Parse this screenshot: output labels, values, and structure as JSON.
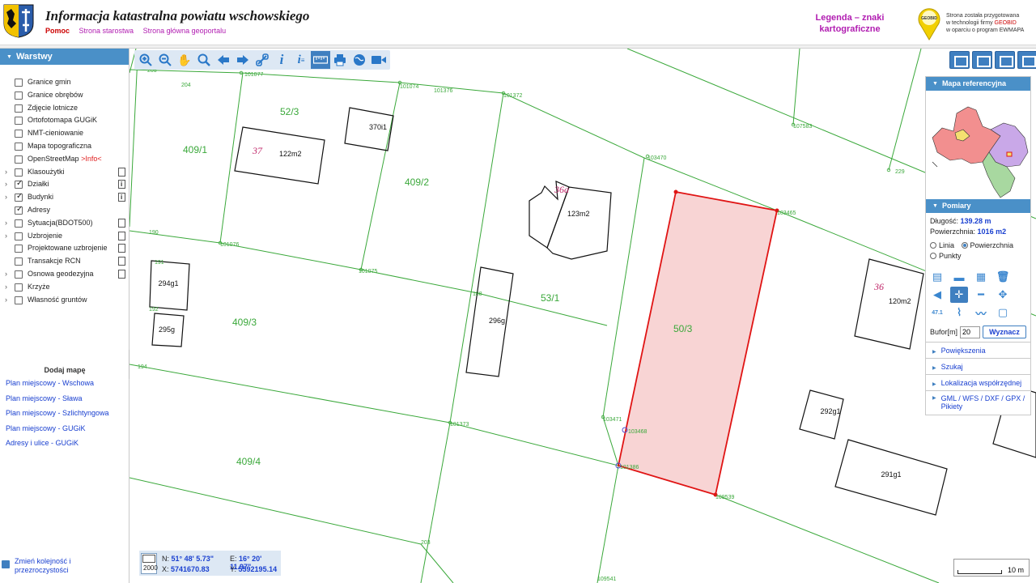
{
  "header": {
    "title": "Informacja katastralna powiatu wschowskiego",
    "links": [
      "Pomoc",
      "Strona starostwa",
      "Strona główna geoportalu"
    ],
    "legend_line1": "Legenda – znaki",
    "legend_line2": "kartograficzne",
    "geobid_line1": "Strona została przygotowana",
    "geobid_line2": "w technologii firmy",
    "geobid_brand": "GEOBID",
    "geobid_line3": "w oparciu o program EWMAPA",
    "geobid_logo_text": "GEOBID"
  },
  "layers_panel": {
    "title": "Warstwy",
    "items": [
      {
        "label": "Granice gmin",
        "checked": false,
        "expandable": false,
        "doc": ""
      },
      {
        "label": "Granice obrębów",
        "checked": false,
        "expandable": false,
        "doc": ""
      },
      {
        "label": "Zdjęcie lotnicze",
        "checked": false,
        "expandable": false,
        "doc": ""
      },
      {
        "label": "Ortofotomapa GUGiK",
        "checked": false,
        "expandable": false,
        "doc": ""
      },
      {
        "label": "NMT-cieniowanie",
        "checked": false,
        "expandable": false,
        "doc": ""
      },
      {
        "label": "Mapa topograficzna",
        "checked": false,
        "expandable": false,
        "doc": ""
      },
      {
        "label": "OpenStreetMap",
        "info": ">Info<",
        "checked": false,
        "expandable": false,
        "doc": ""
      },
      {
        "label": "Klasoużytki",
        "checked": false,
        "expandable": true,
        "doc": "plain"
      },
      {
        "label": "Działki",
        "checked": true,
        "expandable": true,
        "doc": "info"
      },
      {
        "label": "Budynki",
        "checked": true,
        "expandable": true,
        "doc": "info"
      },
      {
        "label": "Adresy",
        "checked": true,
        "expandable": false,
        "doc": ""
      },
      {
        "label": "Sytuacja(BDOT500)",
        "checked": false,
        "expandable": true,
        "doc": "plain"
      },
      {
        "label": "Uzbrojenie",
        "checked": false,
        "expandable": true,
        "doc": "plain"
      },
      {
        "label": "Projektowane uzbrojenie",
        "checked": false,
        "expandable": false,
        "doc": "plain"
      },
      {
        "label": "Transakcje RCN",
        "checked": false,
        "expandable": false,
        "doc": "plain"
      },
      {
        "label": "Osnowa geodezyjna",
        "checked": false,
        "expandable": true,
        "doc": "plain"
      },
      {
        "label": "Krzyże",
        "checked": false,
        "expandable": true,
        "doc": ""
      },
      {
        "label": "Własność gruntów",
        "checked": false,
        "expandable": true,
        "doc": ""
      }
    ],
    "add_map": "Dodaj mapę",
    "plans": [
      "Plan miejscowy - Wschowa",
      "Plan miejscowy - Sława",
      "Plan miejscowy - Szlichtyngowa",
      "Plan miejscowy - GUGiK",
      "Adresy i ulice - GUGiK"
    ],
    "bottom_link_line1": "Zmień kolejność i",
    "bottom_link_line2": "przezroczystości"
  },
  "toolbar": {
    "tools": [
      "zoom-in",
      "zoom-out",
      "pan",
      "zoom-box",
      "back",
      "forward",
      "link",
      "info",
      "info-list",
      "measure",
      "print",
      "globe",
      "camera"
    ],
    "active": "measure"
  },
  "ref_map": {
    "title": "Mapa referencyjna"
  },
  "measure": {
    "title": "Pomiary",
    "length_label": "Długość:",
    "length_value": "139.28 m",
    "area_label": "Powierzchnia:",
    "area_value": "1016 m2",
    "mode_line": "Linia",
    "mode_area": "Powierzchnia",
    "mode_points": "Punkty",
    "selected_mode": "Powierzchnia",
    "bufor_label": "Bufor[m]",
    "bufor_value": "20",
    "compute_button": "Wyznacz",
    "small_tool_label": "47.1"
  },
  "accordion": [
    "Powiększenia",
    "Szukaj",
    "Lokalizacja współrzędnej"
  ],
  "accordion_export_line1": "GML / WFS / DXF / GPX /",
  "accordion_export_line2": "Pikiety",
  "coords": {
    "n_label": "N:",
    "n_value": "51° 48' 5.73\"",
    "e_label": "E:",
    "e_value": "16° 20' 11.97\"",
    "x_label": "X:",
    "x_value": "5741670.83",
    "y_label": "Y:",
    "y_value": "5592195.14",
    "box_text": "2000"
  },
  "scale": {
    "label": "10 m"
  },
  "map": {
    "parcels": [
      "409/1",
      "52/3",
      "409/2",
      "53/1",
      "50/3",
      "409/3",
      "409/4"
    ],
    "buildings": [
      {
        "area": "122m2",
        "number": "37"
      },
      {
        "area": "370i1",
        "number": ""
      },
      {
        "area": "123m2",
        "number": "36a"
      },
      {
        "area": "294g1",
        "number": ""
      },
      {
        "area": "295g",
        "number": ""
      },
      {
        "area": "296g",
        "number": ""
      },
      {
        "area": "120m2",
        "number": "36"
      },
      {
        "area": "292g1",
        "number": ""
      },
      {
        "area": "291g1",
        "number": ""
      }
    ],
    "points": [
      "205",
      "204",
      "101077",
      "101074",
      "101376",
      "101372",
      "107583",
      "103470",
      "229",
      "103465",
      "190",
      "101076",
      "101075",
      "191",
      "192",
      "188",
      "194",
      "101373",
      "103471",
      "103468",
      "101386",
      "109539",
      "203",
      "109541"
    ],
    "colors": {
      "parcel_line": "#3aa83a",
      "selected_fill": "#f8d4d4",
      "selected_stroke": "#e01414",
      "building": "#111111"
    }
  }
}
